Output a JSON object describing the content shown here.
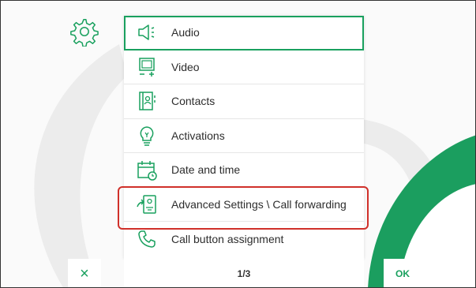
{
  "colors": {
    "accent": "#19a05e",
    "highlight": "#d0302a",
    "bgShape": "#e8e8e8"
  },
  "header": {
    "settings_icon": "gear-icon"
  },
  "menu": {
    "items": [
      {
        "label": "Audio",
        "icon": "speaker-icon",
        "selected": true
      },
      {
        "label": "Video",
        "icon": "monitor-icon"
      },
      {
        "label": "Contacts",
        "icon": "contacts-book-icon"
      },
      {
        "label": "Activations",
        "icon": "lightbulb-icon"
      },
      {
        "label": "Date and time",
        "icon": "calendar-clock-icon"
      },
      {
        "label": "Advanced Settings \\ Call forwarding",
        "icon": "call-forwarding-icon"
      },
      {
        "label": "Call button assignment",
        "icon": "phone-icon"
      }
    ]
  },
  "footer": {
    "cancel_label": "×",
    "page": "1/3",
    "ok_label": "OK"
  }
}
